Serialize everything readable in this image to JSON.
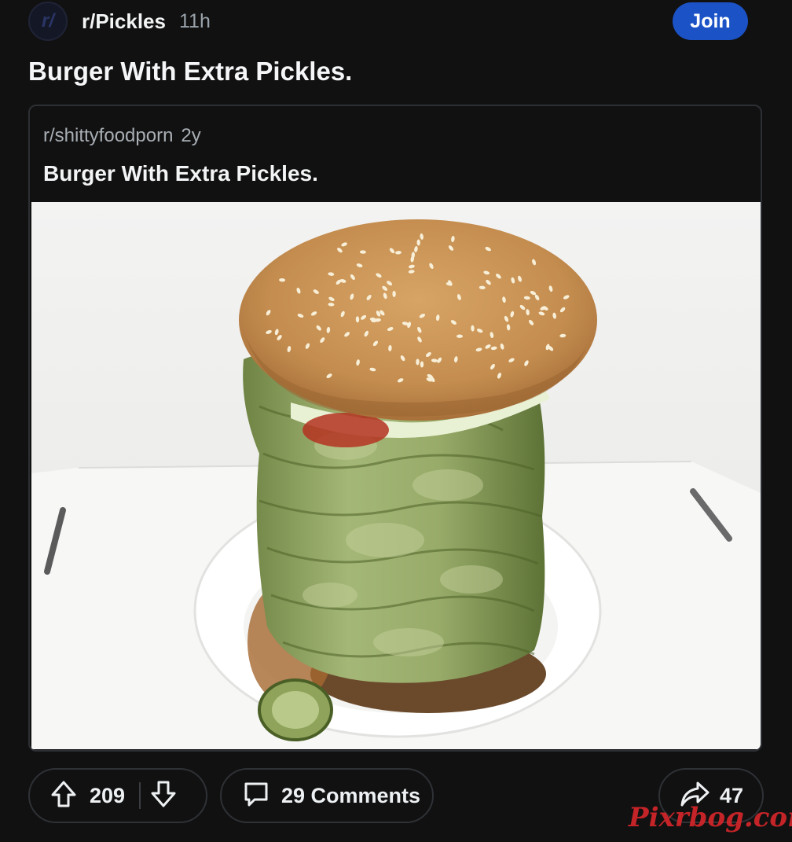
{
  "header": {
    "avatar_text": "r/",
    "subreddit": "r/Pickles",
    "age": "11h",
    "join_label": "Join"
  },
  "post": {
    "title": "Burger With Extra Pickles."
  },
  "crosspost": {
    "subreddit": "r/shittyfoodporn",
    "age": "2y",
    "title": "Burger With Extra Pickles."
  },
  "actions": {
    "upvotes": "209",
    "comments_label": "29 Comments",
    "shares": "47"
  },
  "watermark": "Pixrbog.com",
  "colors": {
    "background": "#111111",
    "join_button": "#1b53c7",
    "border": "#2e3135",
    "watermark": "#d4262a"
  },
  "icons": [
    "upvote-icon",
    "downvote-icon",
    "comment-icon",
    "share-icon"
  ]
}
